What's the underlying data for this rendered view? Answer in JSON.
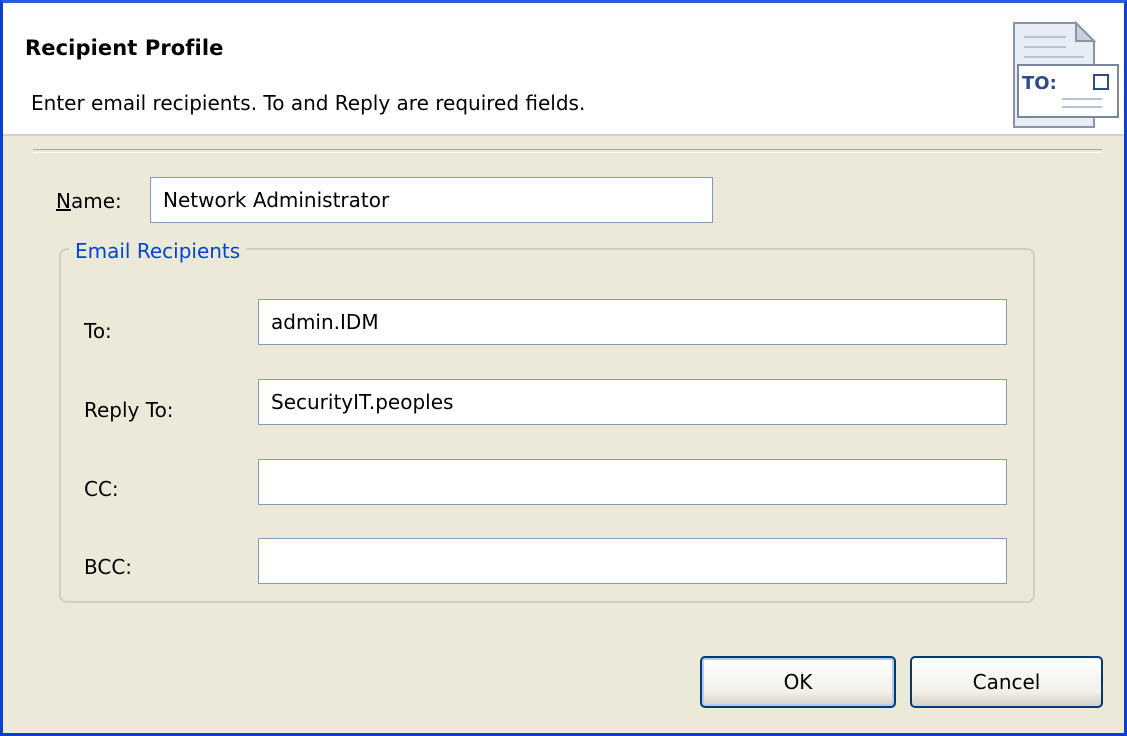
{
  "header": {
    "title": "Recipient Profile",
    "description": "Enter email recipients. To and Reply are required fields.",
    "icon": "email-envelope-icon",
    "icon_text": "TO:"
  },
  "name_field": {
    "label_first": "N",
    "label_rest": "ame:",
    "value": "Network Administrator"
  },
  "group": {
    "title": "Email Recipients",
    "fields": [
      {
        "label": "To:",
        "value": "admin.IDM"
      },
      {
        "label": "Reply To:",
        "value": "SecurityIT.peoples"
      },
      {
        "label": "CC:",
        "value": ""
      },
      {
        "label": "BCC:",
        "value": ""
      }
    ]
  },
  "buttons": {
    "ok": "OK",
    "cancel": "Cancel"
  },
  "colors": {
    "window_border": "#0a3fd0",
    "dialog_background": "#ece9d8",
    "group_title": "#0046d5"
  }
}
